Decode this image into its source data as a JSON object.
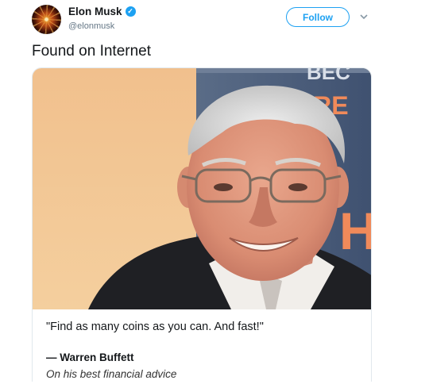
{
  "tweet": {
    "display_name": "Elon Musk",
    "handle": "@elonmusk",
    "verified_icon": "verified-badge-icon",
    "follow_label": "Follow",
    "menu_icon": "chevron-down-icon",
    "text": "Found on Internet"
  },
  "card": {
    "quote": "\"Find as many coins as you can. And fast!\"",
    "author": "— Warren Buffett",
    "caption": "On his best financial advice",
    "backdrop_text": "BEC RRE",
    "backdrop_letter": "H"
  },
  "colors": {
    "accent": "#1da1f2",
    "text": "#14171a",
    "muted": "#657786"
  }
}
